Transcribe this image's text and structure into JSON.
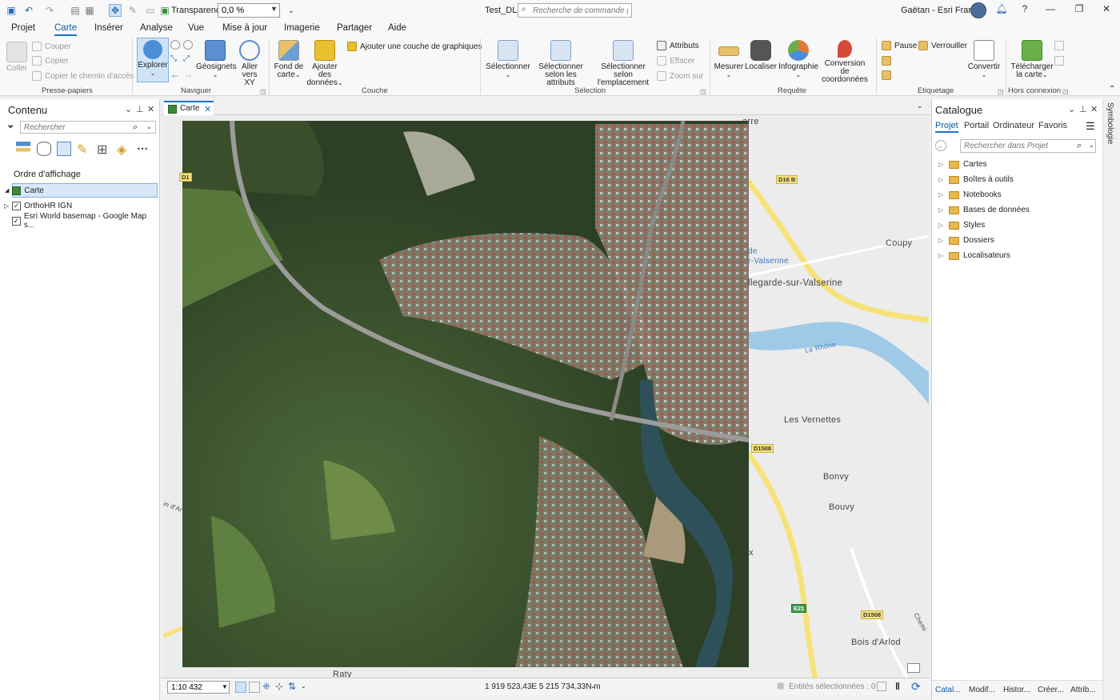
{
  "titlebar": {
    "transparency_label": "Transparence",
    "transparency_value": "0,0 %",
    "doc_title": "Test_DL",
    "command_search_placeholder": "Recherche de commande (Alt+Q)",
    "user": "Gaëtan - Esri France"
  },
  "tabs": [
    "Projet",
    "Carte",
    "Insérer",
    "Analyse",
    "Vue",
    "Mise à jour",
    "Imagerie",
    "Partager",
    "Aide"
  ],
  "ribbon": {
    "clipboard": {
      "paste": "Coller",
      "cut": "Couper",
      "copy": "Copier",
      "copy_path": "Copier le chemin d'accès",
      "label": "Presse-papiers"
    },
    "navigate": {
      "explore": "Explorer",
      "bookmarks": "Géosignets",
      "goto_xy_1": "Aller",
      "goto_xy_2": "vers XY",
      "label": "Naviguer"
    },
    "layer": {
      "basemap_1": "Fond de",
      "basemap_2": "carte",
      "add_data_1": "Ajouter des",
      "add_data_2": "données",
      "add_graphics": "Ajouter une couche de graphiques",
      "label": "Couche"
    },
    "selection": {
      "select": "Sélectionner",
      "by_attr_1": "Sélectionner",
      "by_attr_2": "selon les attributs",
      "by_loc_1": "Sélectionner selon",
      "by_loc_2": "l'emplacement",
      "attributes": "Attributs",
      "clear": "Effacer",
      "zoom_to": "Zoom sur",
      "label": "Sélection"
    },
    "inquiry": {
      "measure": "Mesurer",
      "locate": "Localiser",
      "infographic": "Infographie",
      "convert_coords_1": "Conversion de",
      "convert_coords_2": "coordonnées",
      "label": "Requête"
    },
    "labeling": {
      "pause": "Pause",
      "lock": "Verrouiller",
      "convert": "Convertir",
      "label": "Etiquetage"
    },
    "offline": {
      "download_1": "Télécharger",
      "download_2": "la carte",
      "label": "Hors connexion"
    }
  },
  "contents": {
    "title": "Contenu",
    "search_placeholder": "Rechercher",
    "draw_order": "Ordre d'affichage",
    "layers": [
      {
        "name": "Carte",
        "checked": null,
        "selected": true
      },
      {
        "name": "OrthoHR IGN",
        "checked": true,
        "selected": false
      },
      {
        "name": "Esri World basemap - Google Map s...",
        "checked": true,
        "selected": false
      }
    ]
  },
  "map": {
    "tab_label": "Carte",
    "labels": {
      "coupy": "Coupy",
      "bellegarde": "llegarde-sur-Valserine",
      "valserine_1": "de",
      "valserine_2": "r-Valserine",
      "le_rhone": "Le Rhône",
      "les_vernettes": "Les Vernettes",
      "bonvy": "Bonvy",
      "bouvy": "Bouvy",
      "bois_darlod": "Bois d'Arlod",
      "raty": "Raty",
      "arre": "arre",
      "in_dar": "in d'Ar",
      "chemin": "Chemi",
      "x": "x"
    },
    "shields": {
      "d16b": "D16 B",
      "d1508a": "D1508",
      "d1508b": "D1508",
      "e21": "E21",
      "d1": "D1"
    }
  },
  "status": {
    "scale": "1:10 432",
    "coordinates": "1 919 523,43E 5 215 734,33N m",
    "selected_features": "Entités sélectionnées : 0"
  },
  "catalog": {
    "title": "Catalogue",
    "tabs": [
      "Projet",
      "Portail",
      "Ordinateur",
      "Favoris"
    ],
    "search_placeholder": "Rechercher dans Projet",
    "items": [
      "Cartes",
      "Boîtes à outils",
      "Notebooks",
      "Bases de données",
      "Styles",
      "Dossiers",
      "Localisateurs"
    ],
    "bottom_tabs": [
      "Catal...",
      "Modif...",
      "Histor...",
      "Créer...",
      "Attrib..."
    ]
  },
  "side_strip": {
    "symbology": "Symbologie"
  },
  "colors": {
    "accent": "#1a73c8",
    "explore_active": "#cfe3f7",
    "road_yellow": "#f6e27a",
    "water": "#9ecae8"
  }
}
